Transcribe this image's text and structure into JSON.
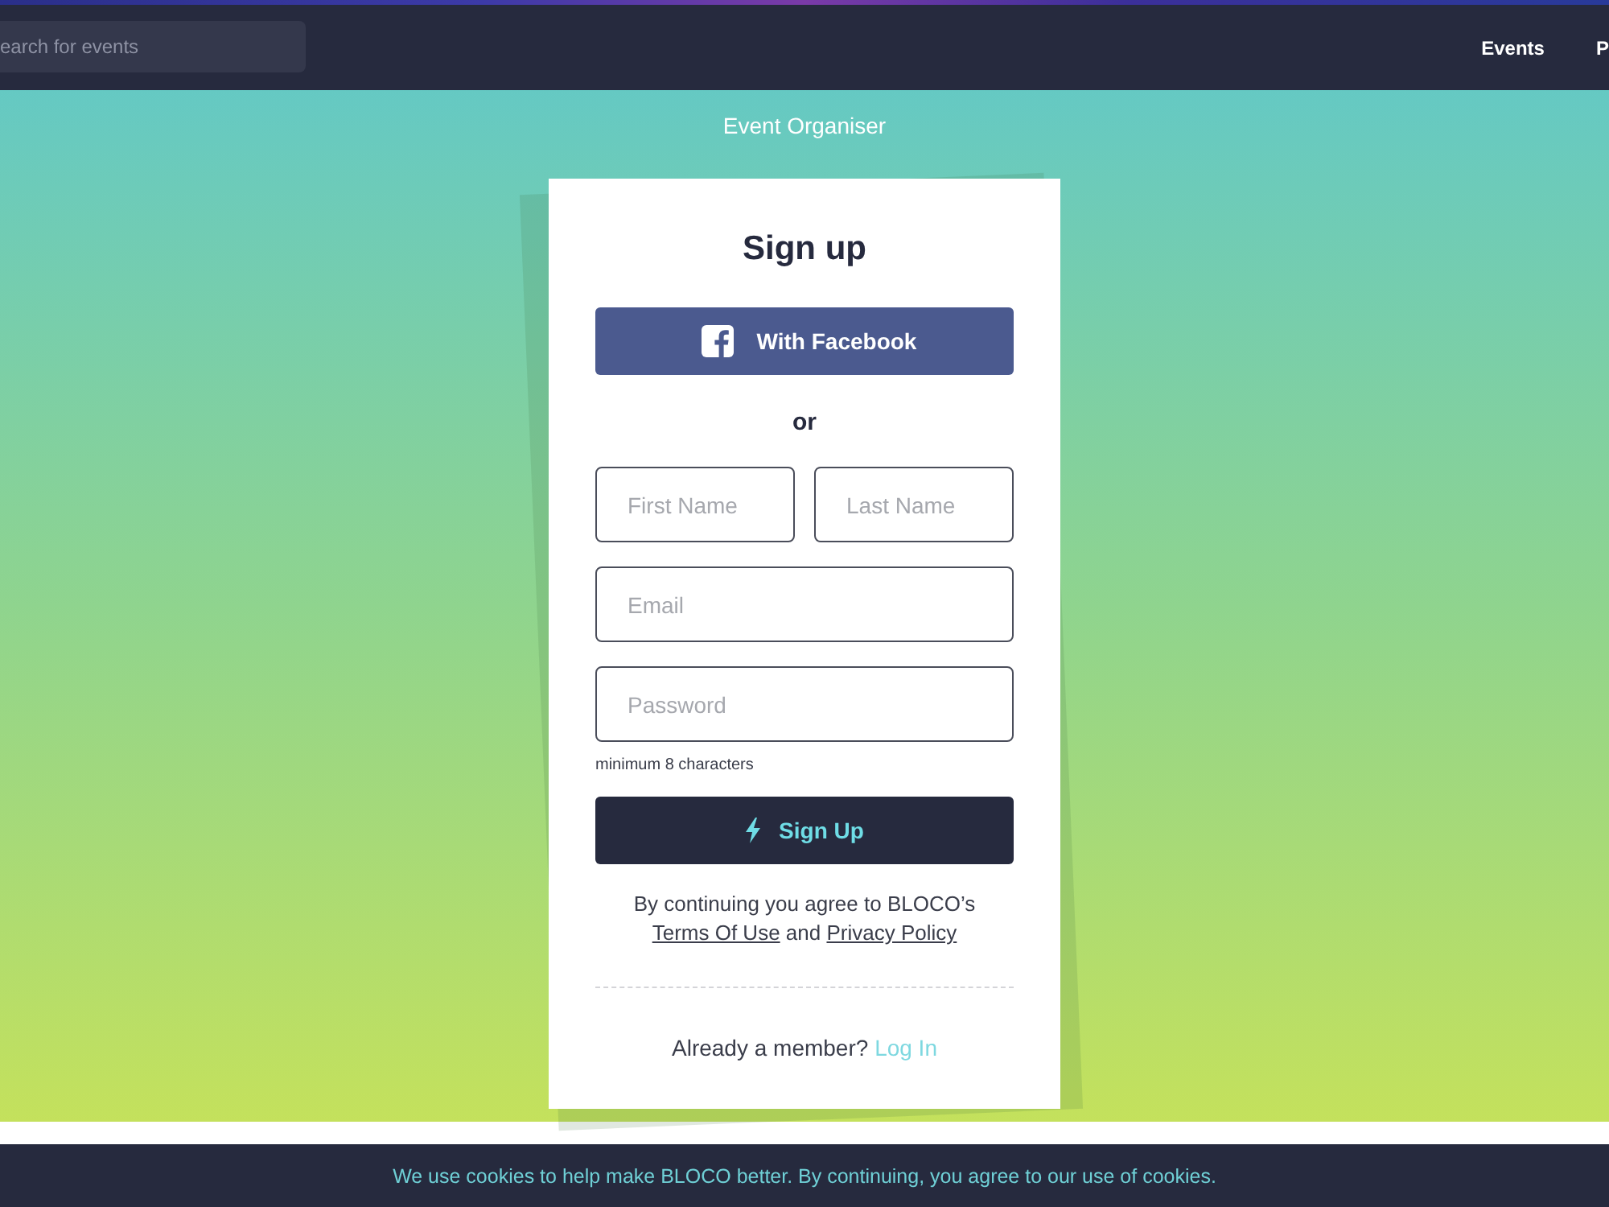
{
  "top_bar": {
    "search": {
      "placeholder": "earch for events"
    },
    "nav_links": [
      {
        "label": "Events"
      },
      {
        "label": "P"
      }
    ]
  },
  "header": {
    "subtitle": "Event Organiser"
  },
  "signup_card": {
    "title": "Sign up",
    "facebook_button": "With Facebook",
    "divider_text": "or",
    "first_name": {
      "placeholder": "First Name"
    },
    "last_name": {
      "placeholder": "Last Name"
    },
    "email": {
      "placeholder": "Email"
    },
    "password": {
      "placeholder": "Password",
      "hint": "minimum 8 characters"
    },
    "submit_button": "Sign Up",
    "terms": {
      "text": "By continuing you agree to BLOCO’s",
      "terms_link": "Terms Of Use",
      "joiner": "and",
      "privacy_link": "Privacy Policy"
    },
    "login": {
      "prompt": "Already a member?",
      "link": "Log In"
    }
  },
  "cookie_banner": {
    "text": "We use cookies to help make BLOCO better. By continuing, you agree to our use of cookies."
  }
}
